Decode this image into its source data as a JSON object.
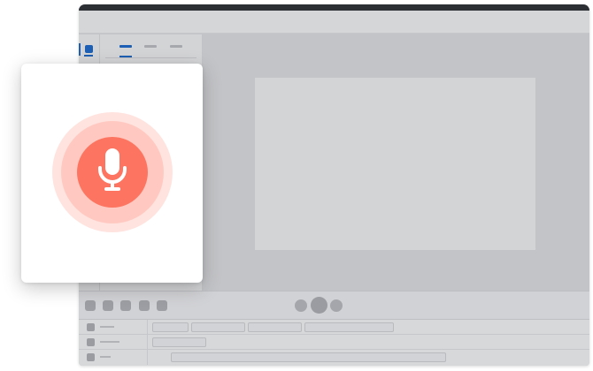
{
  "colors": {
    "accent_blue": "#1d5fb4",
    "mic_circle": "#fd7460",
    "ring_mid": "#ffc9c1",
    "ring_outer": "#ffe3df",
    "window_bg": "#c3c4c7"
  },
  "icons": {
    "record": "microphone-icon"
  }
}
